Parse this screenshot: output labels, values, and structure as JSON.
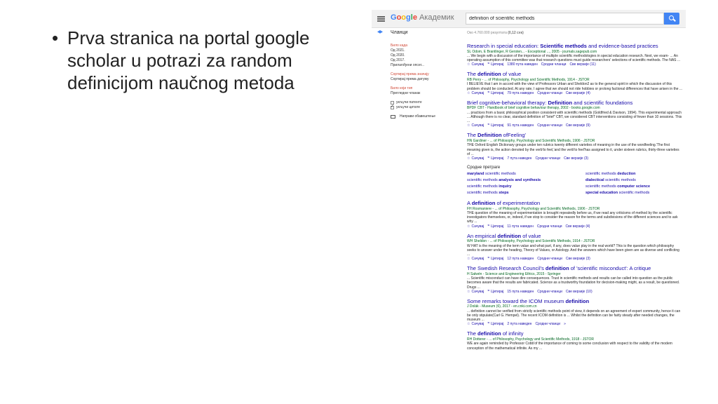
{
  "slide": {
    "bullet": "•",
    "text": "Prva stranica na portal google scholar u potrazi za random definicijom naučnog metoda"
  },
  "scholar": {
    "logo": {
      "g1": "G",
      "g2": "o",
      "g3": "o",
      "g4": "g",
      "g5": "l",
      "g6": "e",
      "suffix": "Академик"
    },
    "search": {
      "value": "definition of scientific methods"
    },
    "articles_label": "Чланци",
    "results_count": "Око 4.760.000 резултата",
    "results_time": "(0,12 сек)",
    "sidebar": {
      "time_header": "Било када",
      "time_items": [
        "Од 2021.",
        "Од 2020.",
        "Од 2017.",
        "Прилагођени опсег..."
      ],
      "sort_relevance": "Сортирај према значају",
      "sort_date": "Сортирај према датуму",
      "type_header": "Било који тип",
      "review_articles": "Прегледни чланак",
      "include_patents": "укључи патенте",
      "include_citations": "укључи цитате",
      "create_alert": "Направи обавештење"
    },
    "link_labels": {
      "save": "Сачувај",
      "cite": "Цитирај",
      "related": "Сродни чланци",
      "versions_prefix": "Све верзије"
    },
    "results": [
      {
        "title_pre": "Research in special education: ",
        "title_bold": "Scientific methods",
        "title_post": " and evidence-based practices",
        "authors": "SL Odom, E Brantlinger, R Gersten... - Exceptional ..., 2005 - journals.sagepub.com",
        "snippet": "... We begin with a discussion of the importance of multiple scientific methodologies in special education research. Next, we exam- ... An operating assumption of this committee was that research questions must guide researchers' selections of scientific methods. The NAS ...",
        "cited": "1380 пута наведен",
        "versions": "Све верзије (11)"
      },
      {
        "title_pre": "The ",
        "title_bold": "definition",
        "title_post": " of value",
        "authors": "RB Perry - ... of Philosophy, Psychology and Scientific Methods, 1914 - JSTOR",
        "snippet": "I BELIEVE that I am in accord with the view of Professors Urban and Sheldon2 as to the general spirit in which the discussion of this problem should be conducted. At any rate, I agree that we should not ride hobbies or prolong factional differences that have arisen in the ...",
        "cited": "79 пута наведен",
        "versions": "Све верзије (4)"
      },
      {
        "title_pre": "Brief cognitive-behavioral therapy: ",
        "title_bold": "Definition",
        "title_post": " and scientific foundations",
        "authors": "BPDF CBT - Handbook of brief cognitive behaviour therapy, 2002 - books.google.com",
        "snippet": "... practices from a basic philosophical position consistent with scientific methods (Goldfried & Davison, 1994). This experimental approach ... Although there is no clear, standard definition of \"brief\" CBT, we considered CBT interventions consisting of fewer than 10 sessions. This ...",
        "cited": "91 пута наведен",
        "versions": "Све верзије (9)"
      },
      {
        "title_pre": "The ",
        "title_bold": "Definition",
        "title_post": " ofFeeling'",
        "authors": "HN Gardiner - ... of Philosophy, Psychology and Scientific Methods, 1906 - JSTOR",
        "snippet": "THE Oxford English Dictionary groups under ten rubrics twenty different varieties of meaning in the use of the wordfeeling.'The first meaning given is, the action denoted by the verb'to feel,'and the verb'to feel'has assigned to it, under sixteen rubrics, thirty-three varieties of ...",
        "cited": "7 пута наведен",
        "versions": "Све верзије (3)"
      }
    ],
    "related": {
      "title": "Сродне претраге",
      "items": [
        {
          "bold": "maryland",
          "rest": " scientific methods",
          "bold_first": true
        },
        {
          "bold": "deduction",
          "rest": "scientific methods ",
          "bold_first": false
        },
        {
          "bold": "analysis and synthesis",
          "rest": "scientific methods ",
          "bold_first": false
        },
        {
          "bold": "dialectical",
          "rest": " scientific methods",
          "bold_first": true
        },
        {
          "bold": "inquiry",
          "rest": "scientific methods ",
          "bold_first": false
        },
        {
          "bold": "computer science",
          "rest": "scientific methods ",
          "bold_first": false
        },
        {
          "bold": "steps",
          "rest": "scientific methods ",
          "bold_first": false
        },
        {
          "bold": "special education",
          "rest": " scientific methods",
          "bold_first": true
        }
      ]
    },
    "results2": [
      {
        "title_pre": "A ",
        "title_bold": "definition",
        "title_post": " of experimentation",
        "authors": "FH Rosmaniere - ... of Philosophy, Psychology and Scientific Methods, 1906 - JSTOR",
        "snippet": "THE question of the meaning of experimentation is brought repeatedly before us, if we read any criticisms of method by the scientific investigators themselves, or, indeed, if we stop to consider the reason for the terms and subdivisions of the different sciences and to ask why ...",
        "cited": "11 пута наведен",
        "versions": "Све верзије (4)"
      },
      {
        "title_pre": "An empirical ",
        "title_bold": "definition",
        "title_post": " of value",
        "authors": "WH Sheldon - ... of Philosophy, Psychology and Scientific Methods, 1914 - JSTOR",
        "snippet": "W HAT is the meaning of the term value and what part, if any, does value play in the real world? This is the question which philosophy seeks to answer under the heading, Theory of Values, or Axiology. And the answers which have been given are as diverse and conflicting ...",
        "cited": "12 пута наведен",
        "versions": "Све верзије (3)"
      },
      {
        "title_pre": "The Swedish Research Council's ",
        "title_bold": "definition",
        "title_post": " of 'scientific misconduct': A critique",
        "authors": "H Salwén - Science and Engineering Ethics, 2015 - Springer",
        "snippet": "... Scientific misconduct can have dire consequences. Trust in scientific methods and results can be called into question as the public becomes aware that the results are fabricated. Science as a trustworthy foundation for decision-making might, as a result, be questioned. Drugs ...",
        "cited": "15 пута наведен",
        "versions": "Све верзије (10)"
      },
      {
        "title_pre": "Some remarks toward the ICOM museum ",
        "title_bold": "definition",
        "title_post": "",
        "authors": "J Dolák - Museum (6), 2017 - en.cnki.com.cn",
        "snippet": "... definition cannot be verified from strictly scientific methods point of view, it depends on an agreement of expert community, hence it can be only stipulate(Carl G. Hempel). The recent ICOM definition is ... Whilst the definition can be fairly steady after needed changes, the museum ...",
        "cited": "2 пута наведен",
        "versions": "»"
      },
      {
        "title_pre": "The ",
        "title_bold": "definition",
        "title_post": " of infinity",
        "authors": "RH Dotterer - ... of Philosophy, Psychology and Scientific Methods, 1918 - JSTOR",
        "snippet": "WE are again reminded by Professor Cobb'of the importance of coming to some conclusion with respect to the validity of the modern conception of the mathematical infinite. As my ...",
        "cited": "",
        "versions": ""
      }
    ]
  }
}
